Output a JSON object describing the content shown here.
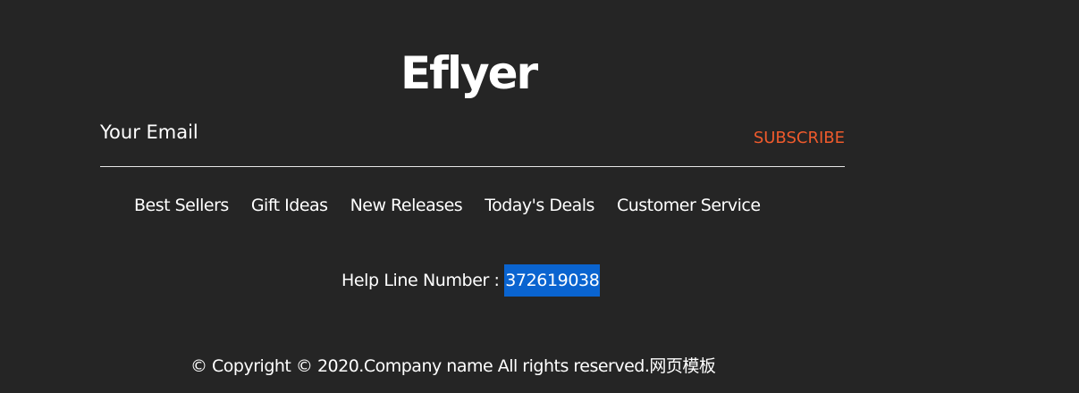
{
  "brand": {
    "name": "Eflyer"
  },
  "newsletter": {
    "email_placeholder": "Your Email",
    "email_value": "",
    "subscribe_label": "SUBSCRIBE"
  },
  "nav": {
    "items": [
      {
        "label": "Best Sellers"
      },
      {
        "label": "Gift Ideas"
      },
      {
        "label": "New Releases"
      },
      {
        "label": "Today's Deals"
      },
      {
        "label": "Customer Service"
      }
    ]
  },
  "helpline": {
    "label": "Help Line Number : ",
    "number": "372619038",
    "number_selected": true
  },
  "footer": {
    "copyright": "© Copyright © 2020.Company name All rights reserved.网页模板"
  },
  "colors": {
    "background": "#252525",
    "text": "#ffffff",
    "accent": "#ee5a2c",
    "selection_bg": "#0a64d0",
    "underline": "#e6e6e6"
  }
}
